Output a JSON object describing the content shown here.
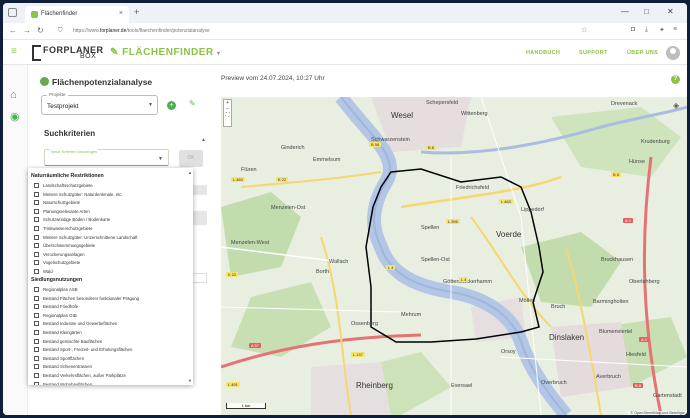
{
  "browser": {
    "tab_title": "Flächenfinder",
    "url_prefix": "https://www.",
    "url_domain": "forplaner.de",
    "url_path": "/tools/flaechenfinder/potenzialanalyse",
    "new_tab": "+",
    "tab_close": "×"
  },
  "header": {
    "logo_main": "FORPLANER",
    "logo_sub": "BOX",
    "product": "FLÄCHENFINDER",
    "links": [
      "HANDBUCH",
      "SUPPORT",
      "ÜBER UNS"
    ]
  },
  "panel": {
    "title": "Flächenpotenzialanalyse",
    "project_label": "Projekte",
    "project_value": "Testprojekt",
    "search_heading": "Suchkriterien",
    "criterion_placeholder": "Neue Kriterien hinzufügen",
    "ok_label": "OK"
  },
  "dropdown": {
    "section1": "Naturräumliche Restriktionen",
    "section1_items": [
      "Landschaftsschutzgebiete",
      "Weitere Schutzgüter: Naturdenkmale, etc.",
      "Naturschutzgebiete",
      "Planungsrelevante Arten",
      "Schutzwürdige Böden / Bodenkarte",
      "Trinkwasserschutzgebiete",
      "Weitere Schutzgüter: Unzerschnittene Landschaft",
      "Überschwemmungsgebiete",
      "Verockerungsanlagen",
      "Vogelschutzgebiete",
      "Wald"
    ],
    "section2": "Siedlungsnutzungen",
    "section2_items": [
      "Regionalplan ASB",
      "Bestand Flächen besonderer funktionaler Prägung",
      "Bestand Friedhöfe",
      "Regionalplan GIB",
      "Bestand Industrie und Gewerbeflächen",
      "Bestand Kleingärten",
      "Bestand gemischte Bauflächen",
      "Bestand Sport-, Freizeit- und Erholungsflächen",
      "Bestand Sportflächen",
      "Bestand Schienentrassen",
      "Bestand Verkehrsflächen, außer Parkplätze",
      "Bestand Wohnbauflächen"
    ]
  },
  "preview": {
    "text": "Preview vom 24.07.2024, 10:27 Uhr"
  },
  "map": {
    "places": [
      {
        "name": "Schepersfeld",
        "big": false
      },
      {
        "name": "Wesel",
        "big": true
      },
      {
        "name": "Wittenberg",
        "big": false
      },
      {
        "name": "Drevenack",
        "big": false
      },
      {
        "name": "Friedrichsfeld",
        "big": false
      },
      {
        "name": "Spellen",
        "big": false
      },
      {
        "name": "Voerde",
        "big": true
      },
      {
        "name": "Götterswickerhamm",
        "big": false
      },
      {
        "name": "Mehrum",
        "big": false
      },
      {
        "name": "Möllen",
        "big": false
      },
      {
        "name": "Bruch",
        "big": false
      },
      {
        "name": "Dinslaken",
        "big": true
      },
      {
        "name": "Rheinberg",
        "big": true
      },
      {
        "name": "Orsoy",
        "big": false
      },
      {
        "name": "Eversael",
        "big": false
      },
      {
        "name": "Ossenberg",
        "big": false
      },
      {
        "name": "Borth",
        "big": false
      },
      {
        "name": "Wallach",
        "big": false
      },
      {
        "name": "Menzelen-Ost",
        "big": false
      },
      {
        "name": "Menzelen-West",
        "big": false
      },
      {
        "name": "Ginderich",
        "big": false
      },
      {
        "name": "Hünxe",
        "big": false
      },
      {
        "name": "Bruckhausen",
        "big": false
      },
      {
        "name": "Hiesfeld",
        "big": false
      },
      {
        "name": "Oberlohberg",
        "big": false
      },
      {
        "name": "Blumenviertel",
        "big": false
      },
      {
        "name": "Averbruch",
        "big": false
      },
      {
        "name": "Overbruch",
        "big": false
      },
      {
        "name": "Gartenstadt",
        "big": false
      },
      {
        "name": "Emmelsum",
        "big": false
      },
      {
        "name": "Spellen-Ost",
        "big": false
      },
      {
        "name": "Flüren",
        "big": false
      },
      {
        "name": "Krudenburg",
        "big": false
      },
      {
        "name": "Lippedorf",
        "big": false
      },
      {
        "name": "Schwarzenstein",
        "big": false
      },
      {
        "name": "Barmingholten",
        "big": false
      }
    ],
    "roads": [
      "B 58",
      "B 8",
      "L 460",
      "K 22",
      "L 396",
      "L 463",
      "L 4",
      "K 22",
      "L 137",
      "A 57",
      "L 491",
      "A 3",
      "B 8",
      "A 3",
      "B 8",
      "L 4"
    ],
    "scale": "1 km",
    "attribution": "© OpenStreetMap und Beteiligte"
  },
  "colors": {
    "accent": "#8bc34a",
    "river": "#b3c6e6",
    "boundary": "#000000"
  }
}
